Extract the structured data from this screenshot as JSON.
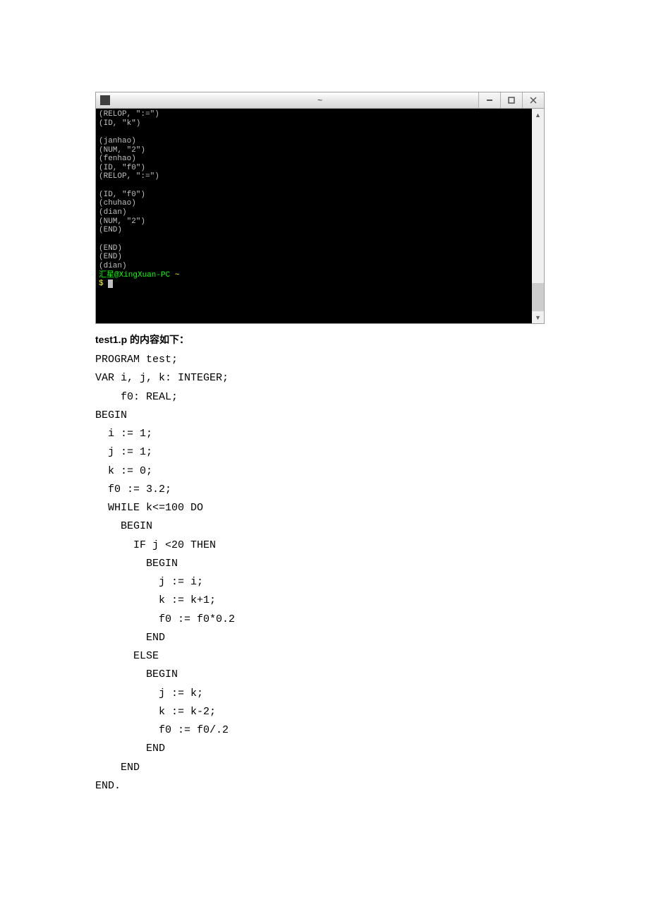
{
  "window": {
    "title": "~",
    "minimize_label": "minimize",
    "maximize_label": "maximize",
    "close_label": "close"
  },
  "terminal": {
    "lines": [
      "(RELOP, \":=\")",
      "(ID, \"k\")",
      "",
      "(janhao)",
      "(NUM, \"2\")",
      "(fenhao)",
      "(ID, \"f0\")",
      "(RELOP, \":=\")",
      "",
      "(ID, \"f0\")",
      "(chuhao)",
      "(dian)",
      "(NUM, \"2\")",
      "(END)",
      "",
      "(END)",
      "(END)",
      "(dian)",
      ""
    ],
    "prompt_user": "汇星@XingXuan-PC",
    "prompt_tilde": " ~",
    "prompt_dollar": "$ "
  },
  "section_heading": "test1.p 的内容如下：",
  "code": "PROGRAM test;\nVAR i, j, k: INTEGER;\n    f0: REAL;\nBEGIN\n  i := 1;\n  j := 1;\n  k := 0;\n  f0 := 3.2;\n  WHILE k<=100 DO\n    BEGIN\n      IF j <20 THEN\n        BEGIN\n          j := i;\n          k := k+1;\n          f0 := f0*0.2\n        END\n      ELSE\n        BEGIN\n          j := k;\n          k := k-2;\n          f0 := f0/.2\n        END\n    END\nEND."
}
